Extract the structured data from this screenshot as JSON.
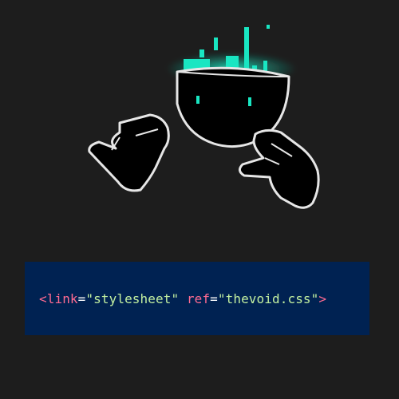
{
  "colors": {
    "background": "#1d1d1d",
    "code_panel": "#002252",
    "glow": "#19e6c2",
    "tag": "#ff6b91",
    "string": "#c3f0a0",
    "outline": "#e6e6e6"
  },
  "illustration": {
    "icon": "bowl-with-cyan-equalizer-and-waving-hands"
  },
  "code": {
    "open": "<",
    "tag_name": "link",
    "eq1": "=",
    "value1": "\"stylesheet\"",
    "space": " ",
    "attr": "ref",
    "eq2": "=",
    "value2": "\"thevoid.css\"",
    "close": ">"
  }
}
